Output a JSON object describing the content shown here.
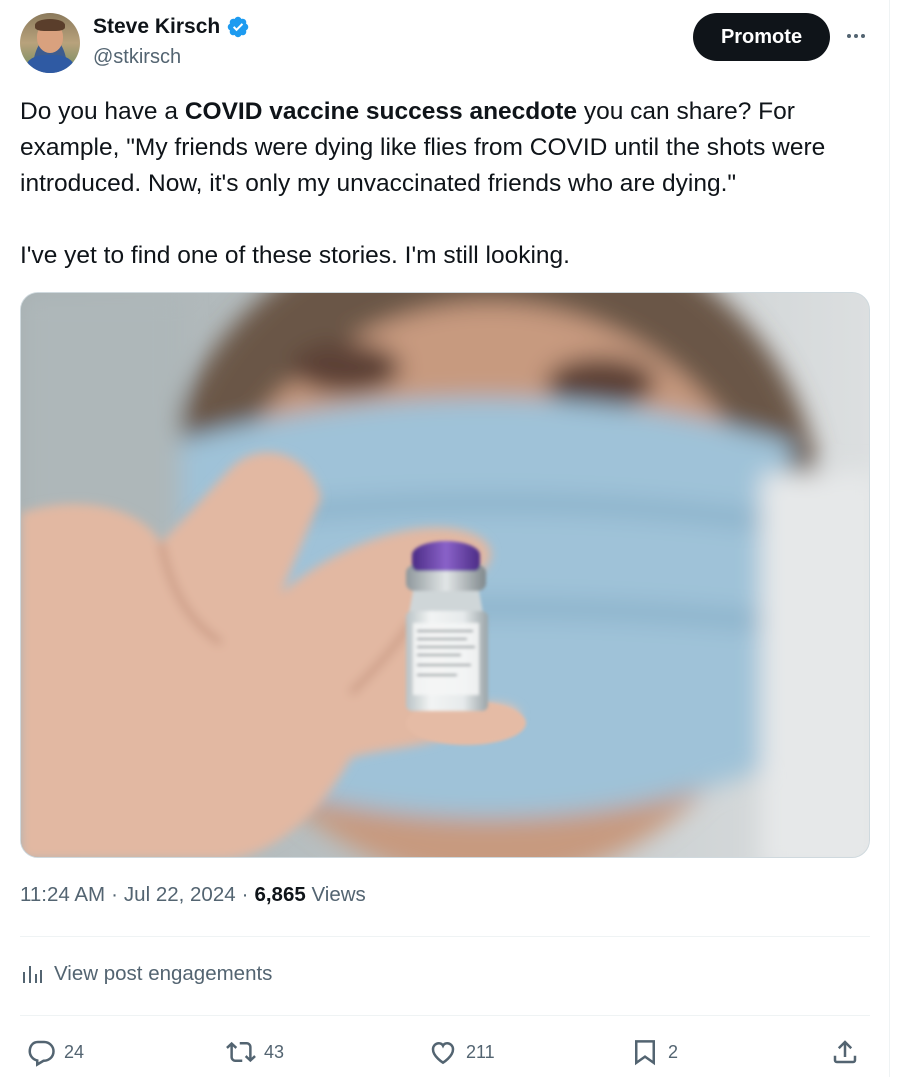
{
  "author": {
    "display_name": "Steve Kirsch",
    "handle": "@stkirsch",
    "verified_icon": "verified-badge-icon"
  },
  "header": {
    "promote_label": "Promote",
    "more_icon": "more-horizontal-icon"
  },
  "tweet": {
    "line1_pre": "Do you have a ",
    "line1_bold": "COVID vaccine success anecdote",
    "line1_post": " you can share? For example, \"My friends were dying like flies from COVID until the shots were introduced. Now, it's only my unvaccinated friends who are dying.\"",
    "line2": "I've yet to find one of these stories. I'm still looking."
  },
  "meta": {
    "time": "11:24 AM",
    "separator": "·",
    "date": "Jul 22, 2024",
    "views_count": "6,865",
    "views_label": "Views"
  },
  "engagements": {
    "icon": "analytics-icon",
    "label": "View post engagements"
  },
  "actions": {
    "reply_count": "24",
    "repost_count": "43",
    "like_count": "211",
    "bookmark_count": "2"
  },
  "colors": {
    "text_primary": "#0f1419",
    "text_secondary": "#536471",
    "verified_blue": "#1d9bf0",
    "divider": "#eff3f4"
  }
}
